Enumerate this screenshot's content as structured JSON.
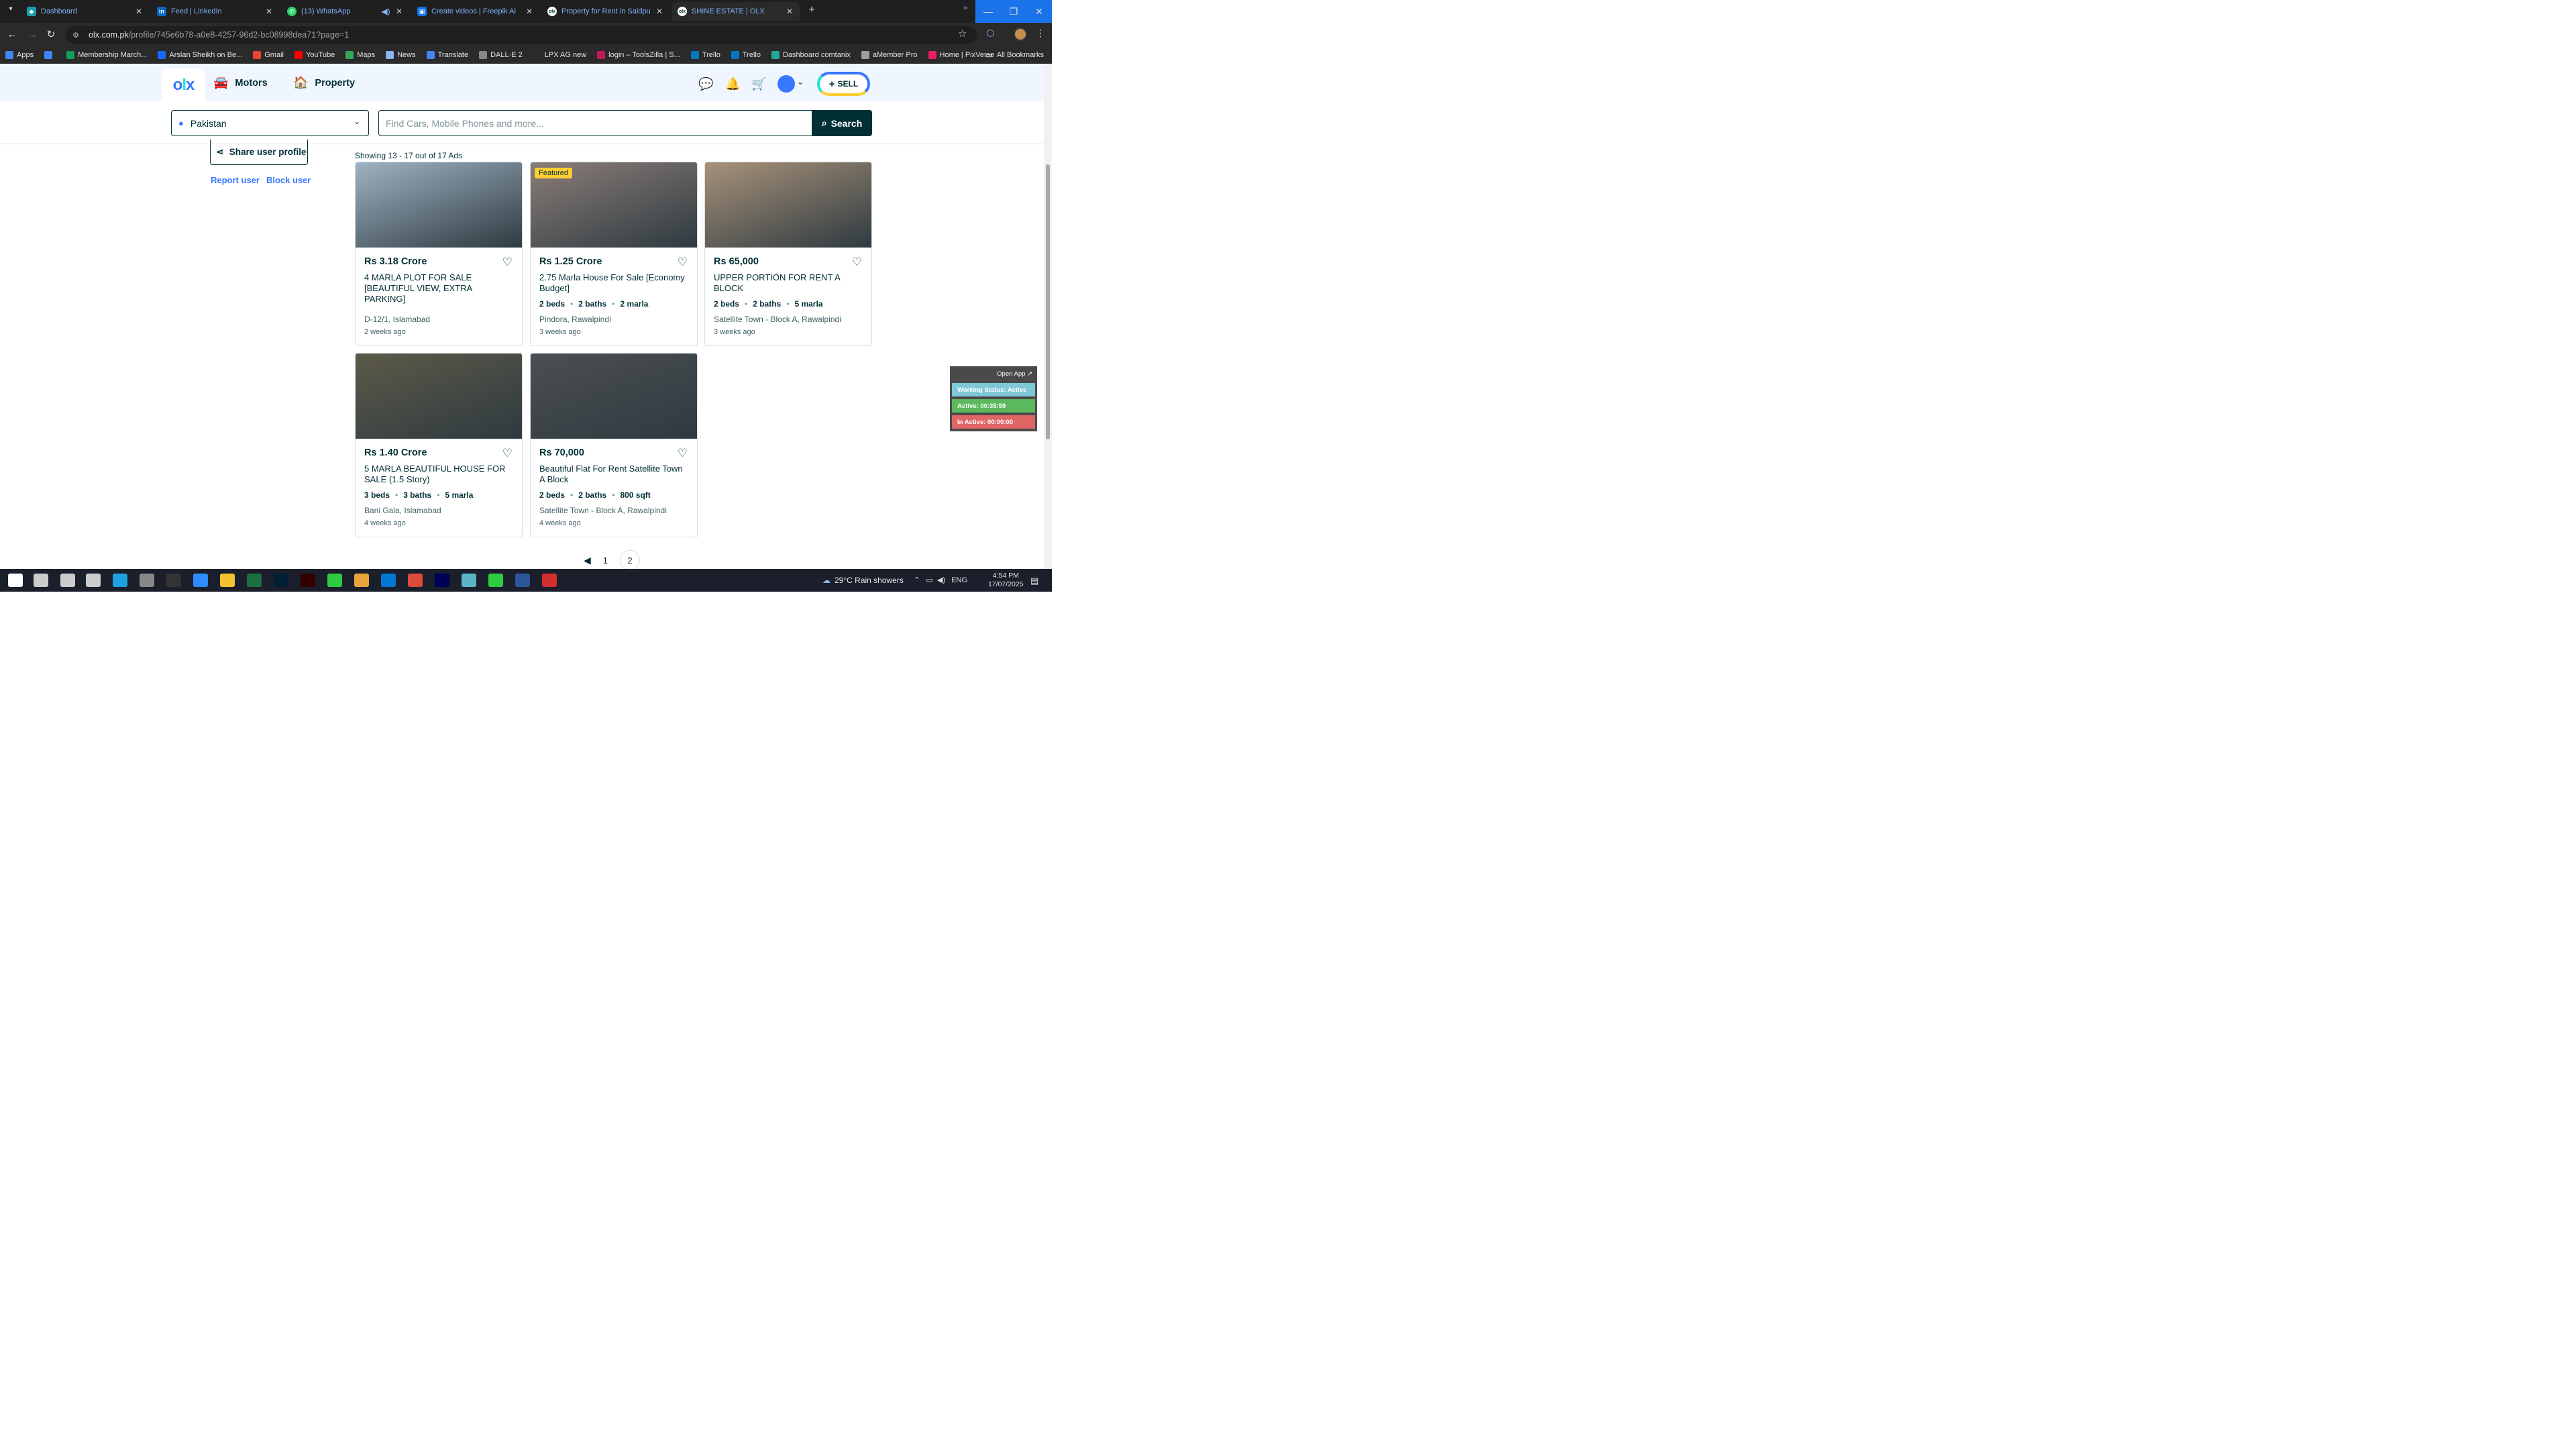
{
  "browser": {
    "tabs": [
      {
        "label": "Dashboard",
        "icon": "dashboard-icon",
        "active": false
      },
      {
        "label": "Feed | LinkedIn",
        "icon": "linkedin-icon",
        "active": false
      },
      {
        "label": "(13) WhatsApp",
        "icon": "whatsapp-icon",
        "active": false
      },
      {
        "label": "Create videos | Freepik AI",
        "icon": "freepik-icon",
        "active": false
      },
      {
        "label": "Property for Rent in Saidpur Ro",
        "icon": "olx-icon",
        "active": false
      },
      {
        "label": "SHINE ESTATE | OLX",
        "icon": "olx-icon",
        "active": true
      }
    ],
    "url_host": "olx.com.pk",
    "url_path": "/profile/745e6b78-a0e8-4257-96d2-bc08998dea71?page=1",
    "bookmarks": [
      {
        "label": "Apps",
        "color": "#4285f4"
      },
      {
        "label": "",
        "color": "#4285f4"
      },
      {
        "label": "Membership March...",
        "color": "#0f9d58"
      },
      {
        "label": "Arslan Sheikh on Be...",
        "color": "#1769ff"
      },
      {
        "label": "Gmail",
        "color": "#ea4335"
      },
      {
        "label": "YouTube",
        "color": "#ff0000"
      },
      {
        "label": "Maps",
        "color": "#34a853"
      },
      {
        "label": "News",
        "color": "#8ab4f8"
      },
      {
        "label": "Translate",
        "color": "#4285f4"
      },
      {
        "label": "DALL·E 2",
        "color": "#888888"
      },
      {
        "label": "LPX AG new",
        "color": "#2a2a2a"
      },
      {
        "label": "login – ToolsZilla | S...",
        "color": "#c2185b"
      },
      {
        "label": "Trello",
        "color": "#0079bf"
      },
      {
        "label": "Trello",
        "color": "#0079bf"
      },
      {
        "label": "Dashboard comtanix",
        "color": "#26a69a"
      },
      {
        "label": "aMember Pro",
        "color": "#9e9e9e"
      },
      {
        "label": "Home | PixVerse",
        "color": "#e91e63"
      }
    ],
    "all_bookmarks": "All Bookmarks"
  },
  "header": {
    "logo": "olx",
    "categories": [
      {
        "label": "Motors",
        "icon": "car-icon"
      },
      {
        "label": "Property",
        "icon": "house-icon"
      }
    ],
    "sell_label": "SELL"
  },
  "search": {
    "location": "Pakistan",
    "placeholder": "Find Cars, Mobile Phones and more...",
    "button_label": "Search"
  },
  "profile": {
    "share_label": "Share user profile",
    "report_label": "Report user",
    "block_label": "Block user"
  },
  "results": {
    "showing": "Showing 13 - 17 out of 17 Ads"
  },
  "listings": [
    {
      "price": "Rs 3.18 Crore",
      "title": "4 MARLA PLOT FOR SALE [BEAUTIFUL VIEW, EXTRA PARKING]",
      "beds": "",
      "baths": "",
      "area": "",
      "location": "D-12/1, Islamabad",
      "ago": "2 weeks ago",
      "featured": "",
      "img": "#9fb3c4"
    },
    {
      "price": "Rs 1.25 Crore",
      "title": "2.75 Marla House For Sale [Economy Budget]",
      "beds": "2 beds",
      "baths": "2 baths",
      "area": "2 marla",
      "location": "Pindora, Rawalpindi",
      "ago": "3 weeks ago",
      "featured": "Featured",
      "img": "#8a7d78"
    },
    {
      "price": "Rs 65,000",
      "title": "UPPER PORTION FOR RENT A BLOCK",
      "beds": "2 beds",
      "baths": "2 baths",
      "area": "5 marla",
      "location": "Satellite Town - Block A, Rawalpindi",
      "ago": "3 weeks ago",
      "featured": "",
      "img": "#a8927a"
    },
    {
      "price": "Rs 1.40 Crore",
      "title": "5 MARLA BEAUTIFUL HOUSE FOR SALE (1.5 Story)",
      "beds": "3 beds",
      "baths": "3 baths",
      "area": "5 marla",
      "location": "Bani Gala, Islamabad",
      "ago": "4 weeks ago",
      "featured": "",
      "img": "#5c5a48"
    },
    {
      "price": "Rs 70,000",
      "title": "Beautiful Flat For Rent Satellite Town A Block",
      "beds": "2 beds",
      "baths": "2 baths",
      "area": "800 sqft",
      "location": "Satellite Town - Block A, Rawalpindi",
      "ago": "4 weeks ago",
      "featured": "",
      "img": "#4c4f52"
    }
  ],
  "pager": {
    "prev": "◀",
    "pages": [
      "1",
      "2"
    ]
  },
  "tracker": {
    "open_app": "Open App ↗",
    "status": "Working Status: Active",
    "active": "Active: 00:35:59",
    "inactive": "In Active: 00:00:00",
    "status_color": "#7ec8d8",
    "active_color": "#5cb85c",
    "inactive_color": "#e06666"
  },
  "taskbar": {
    "weather": "29°C  Rain showers",
    "lang": "ENG",
    "time": "4:54 PM",
    "date": "17/07/2025"
  }
}
